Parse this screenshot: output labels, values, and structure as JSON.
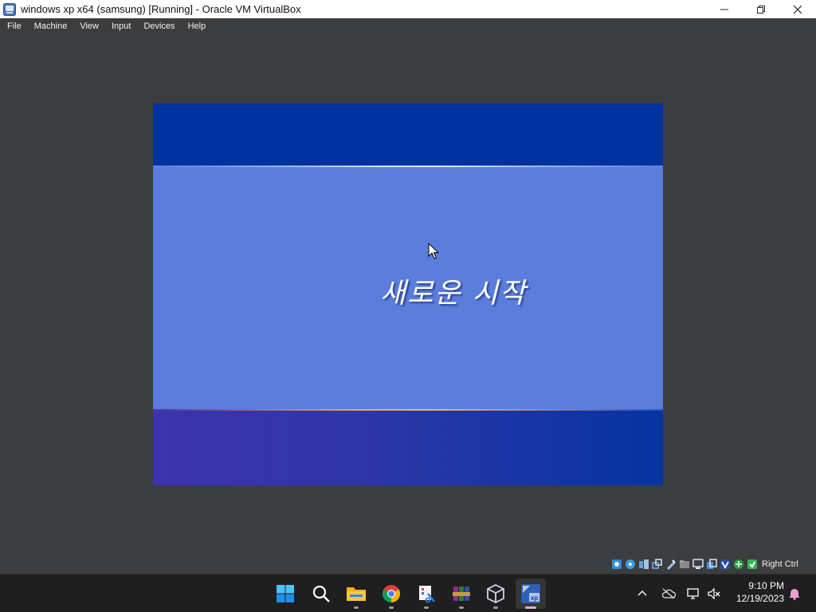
{
  "window": {
    "title": "windows xp x64 (samsung) [Running] - Oracle VM VirtualBox",
    "icon": "virtualbox-vm-icon",
    "controls": [
      "minimize-icon",
      "maximize-icon",
      "close-icon"
    ]
  },
  "menu": {
    "items": [
      "File",
      "Machine",
      "View",
      "Input",
      "Devices",
      "Help"
    ]
  },
  "guest": {
    "welcome_text": "새로운 시작",
    "colors": {
      "top_band": "#0033a0",
      "middle_band": "#5b7edc",
      "bottom_band": "#0534a2",
      "accent_line": "#f4b27c"
    }
  },
  "vm_status": {
    "icons": [
      "hard-disk-icon",
      "optical-drive-icon",
      "audio-icon",
      "network-icon",
      "usb-icon",
      "shared-folders-icon",
      "display-icon",
      "recording-icon",
      "virtualization-icon",
      "mouse-integration-icon",
      "keyboard-icon"
    ],
    "host_key": "Right Ctrl"
  },
  "taskbar": {
    "apps": [
      "windows-start-icon",
      "search-icon",
      "file-explorer-icon",
      "chrome-icon",
      "snipping-tool-icon",
      "winrar-icon",
      "virtualbox-icon",
      "windows-xp-vm-icon"
    ],
    "tray_icons": [
      "chevron-up-icon",
      "cloud-off-icon",
      "network-monitor-icon",
      "volume-muted-icon"
    ],
    "time": "9:10 PM",
    "date": "12/19/2023",
    "notification_icon": "notification-bell-icon"
  }
}
